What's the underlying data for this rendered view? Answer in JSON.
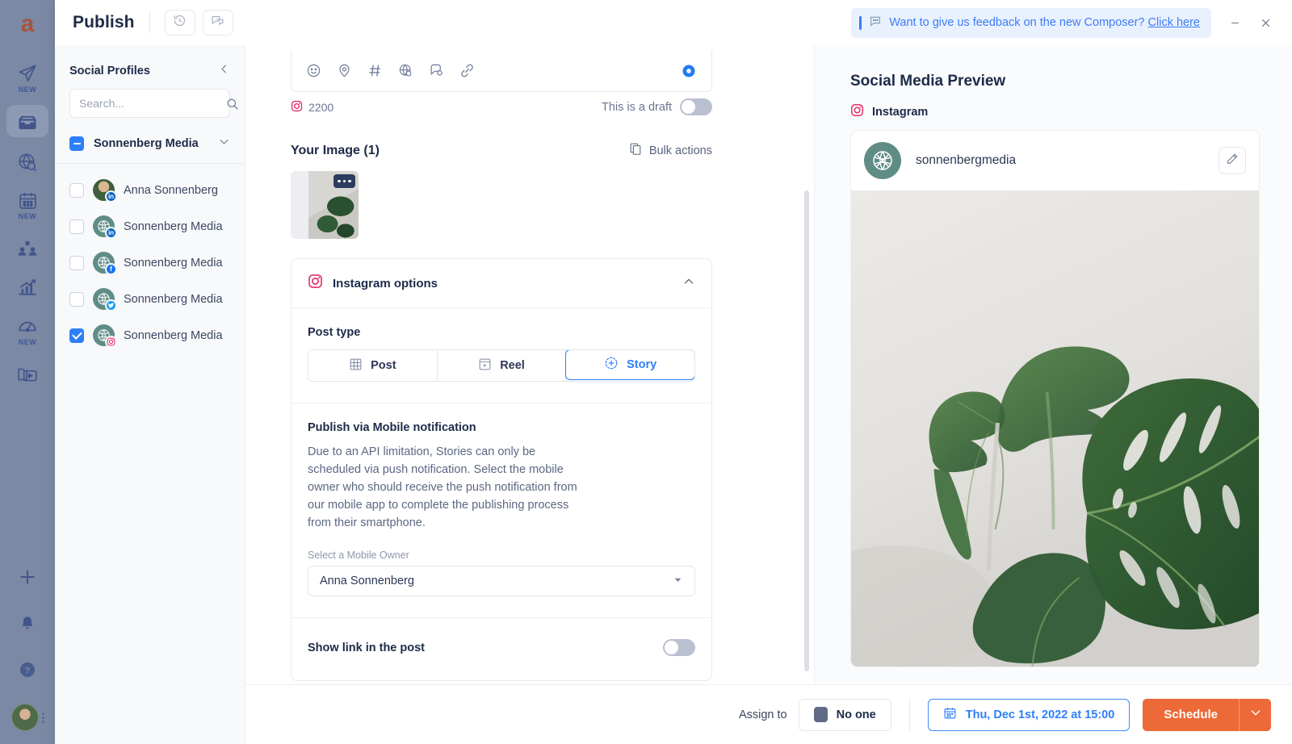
{
  "app": {
    "rail": {
      "logo_letter": "a",
      "items": [
        {
          "icon": "paper-plane-icon",
          "badge": "NEW",
          "active": false
        },
        {
          "icon": "inbox-icon",
          "badge": "",
          "active": true
        },
        {
          "icon": "globe-search-icon",
          "badge": "",
          "active": false
        },
        {
          "icon": "calendar-icon",
          "badge": "NEW",
          "active": false
        },
        {
          "icon": "people-icon",
          "badge": "",
          "active": false
        },
        {
          "icon": "analytics-bars-icon",
          "badge": "",
          "active": false
        },
        {
          "icon": "speedometer-icon",
          "badge": "NEW",
          "active": false
        },
        {
          "icon": "media-folder-icon",
          "badge": "",
          "active": false
        }
      ],
      "bottom_items": [
        {
          "icon": "plus-icon"
        },
        {
          "icon": "bell-icon"
        },
        {
          "icon": "help-question-icon"
        }
      ]
    }
  },
  "titlebar": {
    "title": "Publish",
    "history_icon": "history-clock-icon",
    "comments_icon": "chat-bubbles-icon",
    "feedback": {
      "icon": "speech-bubble-icon",
      "text": "Want to give us feedback on the new Composer?",
      "link": "Click here"
    },
    "minimize_label": "—",
    "close_label": "✕"
  },
  "profiles": {
    "heading": "Social Profiles",
    "collapse_icon": "chevron-left-icon",
    "search": {
      "placeholder": "Search...",
      "value": "",
      "icon": "search-icon"
    },
    "group": {
      "name": "Sonnenberg Media",
      "checkbox_state": "indeterminate",
      "chevron": "chevron-down-icon"
    },
    "items": [
      {
        "name": "Anna Sonnenberg",
        "network": "linkedin",
        "checked": false
      },
      {
        "name": "Sonnenberg Media",
        "network": "linkedin",
        "checked": false
      },
      {
        "name": "Sonnenberg Media",
        "network": "facebook",
        "checked": false
      },
      {
        "name": "Sonnenberg Media",
        "network": "twitter",
        "checked": false
      },
      {
        "name": "Sonnenberg Media",
        "network": "instagram",
        "checked": true
      }
    ]
  },
  "composer": {
    "toolbar_icons": [
      "emoji-icon",
      "location-pin-icon",
      "hashtag-icon",
      "globe-icon",
      "comment-icon",
      "link-icon"
    ],
    "ai_icon": "ai-assist-icon",
    "counter": {
      "network_icon": "instagram-icon",
      "value": "2200"
    },
    "draft": {
      "label": "This is a draft",
      "on": false
    },
    "image_section": {
      "title": "Your Image (1)",
      "bulk_actions": {
        "label": "Bulk actions",
        "icon": "copy-stack-icon"
      },
      "thumbnail_menu_icon": "ellipsis-icon"
    },
    "instagram_options": {
      "header": "Instagram options",
      "header_icon": "instagram-icon",
      "collapse_icon": "chevron-up-icon",
      "post_type": {
        "label": "Post type",
        "options": [
          {
            "label": "Post",
            "icon": "grid-icon",
            "selected": false
          },
          {
            "label": "Reel",
            "icon": "reel-icon",
            "selected": false
          },
          {
            "label": "Story",
            "icon": "story-plus-icon",
            "selected": true
          }
        ]
      },
      "mobile_notification": {
        "title": "Publish via Mobile notification",
        "body": "Due to an API limitation, Stories can only be scheduled via push notification. Select the mobile owner who should receive the push notification from our mobile app to complete the publishing process from their smartphone.",
        "field_label": "Select a Mobile Owner",
        "selected_owner": "Anna Sonnenberg",
        "caret_icon": "caret-down-icon"
      },
      "show_link": {
        "label": "Show link in the post",
        "on": false
      }
    }
  },
  "preview": {
    "title": "Social Media Preview",
    "network": {
      "label": "Instagram",
      "icon": "instagram-icon"
    },
    "account": "sonnenbergmedia",
    "edit_icon": "pencil-icon",
    "image_alt": "monstera-plant-photo"
  },
  "footer": {
    "assign_label": "Assign to",
    "assignee": "No one",
    "date": {
      "icon": "calendar-icon",
      "value": "Thu, Dec 1st, 2022 at 15:00"
    },
    "schedule_label": "Schedule",
    "schedule_caret": "chevron-down-icon"
  },
  "colors": {
    "rail": "#7b89a5",
    "accent_blue": "#2d7ff9",
    "orange": "#ed6937",
    "text_dark": "#1d2b48"
  }
}
